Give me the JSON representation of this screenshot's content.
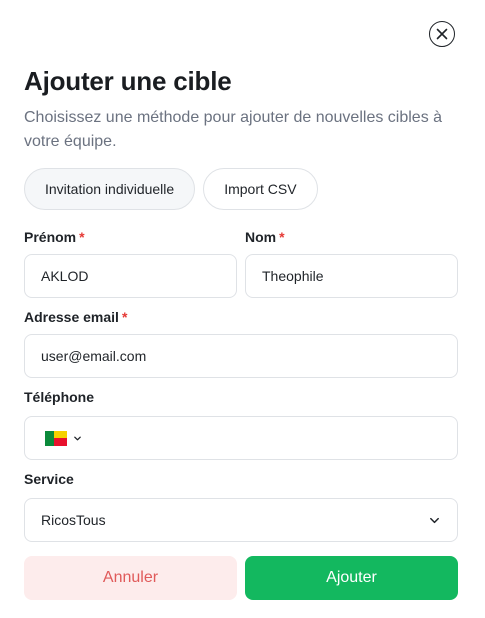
{
  "dialog": {
    "title": "Ajouter une cible",
    "subtitle": "Choisissez une méthode pour ajouter de nouvelles cibles à votre équipe."
  },
  "tabs": [
    {
      "label": "Invitation individuelle",
      "active": true
    },
    {
      "label": "Import CSV",
      "active": false
    }
  ],
  "form": {
    "first_name": {
      "label": "Prénom",
      "required": "*",
      "value": "AKLOD"
    },
    "last_name": {
      "label": "Nom",
      "required": "*",
      "value": "Theophile"
    },
    "email": {
      "label": "Adresse email",
      "required": "*",
      "value": "user@email.com"
    },
    "phone": {
      "label": "Téléphone",
      "value": "",
      "country_flag": "benin-flag-icon"
    },
    "service": {
      "label": "Service",
      "selected": "RicosTous"
    }
  },
  "actions": {
    "cancel_label": "Annuler",
    "add_label": "Ajouter"
  },
  "colors": {
    "accent": "#13b85f",
    "cancel_bg": "#fdecec",
    "cancel_text": "#e05a5a",
    "required": "#e53935"
  }
}
